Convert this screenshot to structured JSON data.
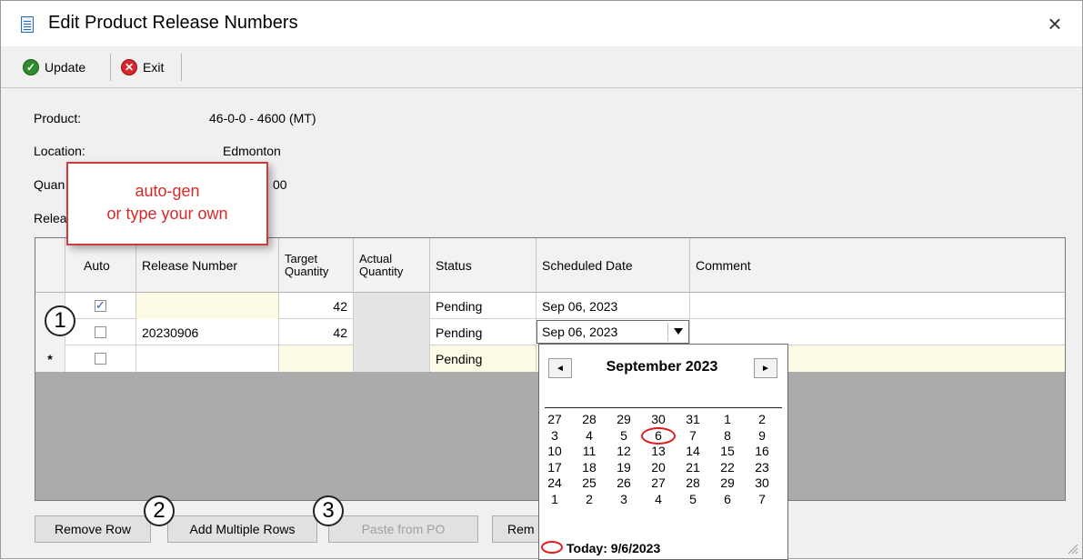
{
  "window": {
    "title": "Edit Product Release Numbers",
    "close_icon": "×"
  },
  "toolbar": {
    "update_label": "Update",
    "exit_label": "Exit"
  },
  "form": {
    "product_label": "Product:",
    "product_value": "46-0-0 - 4600 (MT)",
    "location_label": "Location:",
    "location_value": "Edmonton",
    "quantity_label_partial": "Quan",
    "quantity_value_partial": "00",
    "release_label_partial": "Relea"
  },
  "callout": {
    "line1": "auto-gen",
    "line2": "or type your own"
  },
  "grid": {
    "columns": [
      "",
      "Auto",
      "Release Number",
      "Target Quantity",
      "Actual Quantity",
      "Status",
      "Scheduled Date",
      "Comment"
    ],
    "target_header_line1": "Target",
    "target_header_line2": "Quantity",
    "actual_header_line1": "Actual",
    "actual_header_line2": "Quantity",
    "rows": [
      {
        "indicator": "",
        "auto": true,
        "release": "",
        "target": "42",
        "actual": "",
        "status": "Pending",
        "date": "Sep 06, 2023",
        "comment": ""
      },
      {
        "indicator": "",
        "auto": false,
        "release": "20230906",
        "target": "42",
        "actual": "",
        "status": "Pending",
        "date": "Sep 06, 2023",
        "comment": ""
      },
      {
        "indicator": "*",
        "auto": false,
        "release": "",
        "target": "",
        "actual": "",
        "status": "Pending",
        "date": "",
        "comment": ""
      }
    ]
  },
  "calendar": {
    "month_label": "September 2023",
    "prev_icon": "◄",
    "next_icon": "►",
    "weeks": [
      [
        "27",
        "28",
        "29",
        "30",
        "31",
        "1",
        "2"
      ],
      [
        "3",
        "4",
        "5",
        "6",
        "7",
        "8",
        "9"
      ],
      [
        "10",
        "11",
        "12",
        "13",
        "14",
        "15",
        "16"
      ],
      [
        "17",
        "18",
        "19",
        "20",
        "21",
        "22",
        "23"
      ],
      [
        "24",
        "25",
        "26",
        "27",
        "28",
        "29",
        "30"
      ],
      [
        "1",
        "2",
        "3",
        "4",
        "5",
        "6",
        "7"
      ]
    ],
    "today_label": "Today: 9/6/2023",
    "selected_day": "6"
  },
  "buttons": {
    "remove_row": "Remove Row",
    "add_multiple_rows": "Add Multiple Rows",
    "paste_from_po": "Paste from PO",
    "rem_partial": "Rem"
  },
  "markers": {
    "m1": "1",
    "m2": "2",
    "m3": "3"
  },
  "colors": {
    "accent_red": "#d62a2a",
    "editable_cell": "#fdfbe6",
    "readonly_cell": "#e4e4e4"
  }
}
